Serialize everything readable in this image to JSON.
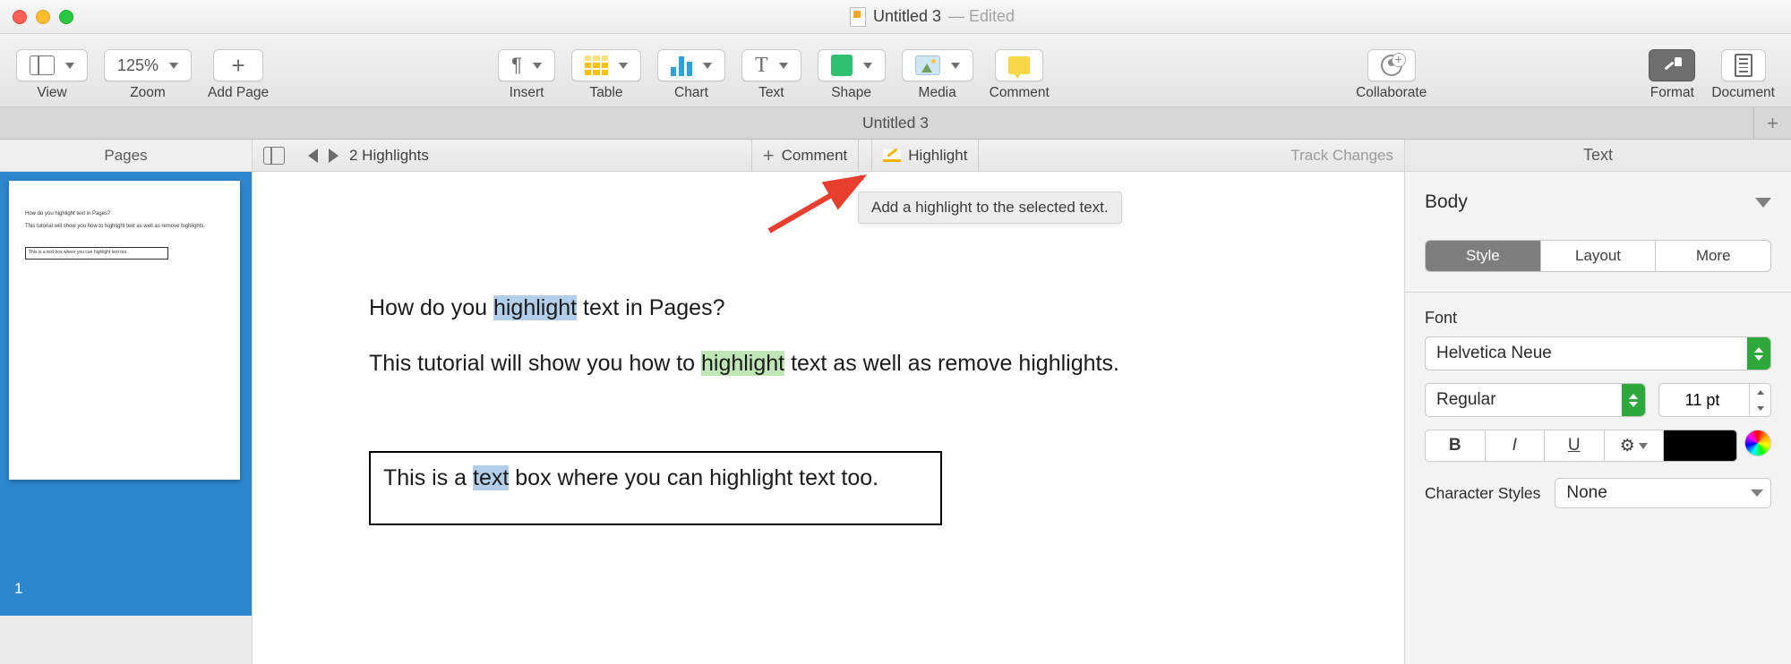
{
  "window": {
    "doc_title": "Untitled 3",
    "edited": "— Edited"
  },
  "toolbar": {
    "view": "View",
    "zoom_value": "125%",
    "zoom_label": "Zoom",
    "add_page": "Add Page",
    "insert": "Insert",
    "table": "Table",
    "chart": "Chart",
    "text": "Text",
    "shape": "Shape",
    "media": "Media",
    "comment": "Comment",
    "collaborate": "Collaborate",
    "format": "Format",
    "document": "Document"
  },
  "tabbar": {
    "tab1": "Untitled 3"
  },
  "pages_sidebar": {
    "title": "Pages",
    "page_num": "1"
  },
  "review_bar": {
    "count_label": "2 Highlights",
    "comment": "Comment",
    "highlight": "Highlight",
    "track": "Track Changes"
  },
  "tooltip": "Add a highlight to the selected text.",
  "document": {
    "p1_before": "How do you ",
    "p1_hl": "highlight",
    "p1_after": " text in Pages?",
    "p2_before": "This tutorial will show you how to ",
    "p2_hl": "highlight",
    "p2_after": " text as well as remove highlights.",
    "textbox_before": "This is a ",
    "textbox_sel": "text",
    "textbox_after": " box where you can highlight text too."
  },
  "inspector": {
    "tab": "Text",
    "para_style": "Body",
    "tabs": {
      "style": "Style",
      "layout": "Layout",
      "more": "More"
    },
    "font_label": "Font",
    "font_name": "Helvetica Neue",
    "font_weight": "Regular",
    "font_size": "11 pt",
    "char_styles_label": "Character Styles",
    "char_styles_value": "None"
  }
}
